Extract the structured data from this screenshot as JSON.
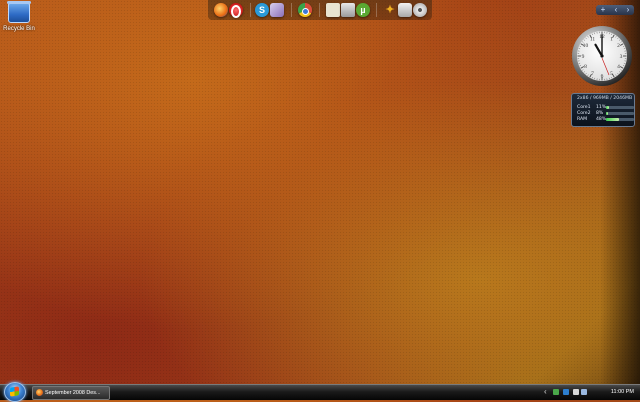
{
  "desktop": {
    "icons": [
      {
        "label": "Recycle Bin",
        "icon": "recycle-bin-icon"
      }
    ]
  },
  "dock": {
    "items": [
      {
        "name": "firefox",
        "icon": "firefox-icon",
        "color": "#e8771c"
      },
      {
        "name": "opera",
        "icon": "opera-icon",
        "color": "#d21f1f"
      },
      {
        "name": "skype",
        "icon": "skype-icon",
        "color": "#2a9ad8"
      },
      {
        "name": "messenger",
        "icon": "messenger-icon",
        "color": "#8a6fb8"
      },
      {
        "name": "chrome",
        "icon": "chrome-icon",
        "color": "#d94c3a"
      },
      {
        "name": "notepad",
        "icon": "notepad-icon",
        "color": "#e8e4d0"
      },
      {
        "name": "installer",
        "icon": "installer-icon",
        "color": "#c9c9c9"
      },
      {
        "name": "utorrent",
        "icon": "utorrent-icon",
        "color": "#5aa832"
      },
      {
        "name": "cleaner",
        "icon": "broom-icon",
        "color": "#f0b020"
      },
      {
        "name": "tools",
        "icon": "tools-icon",
        "color": "#d8d8d8"
      },
      {
        "name": "media",
        "icon": "disc-icon",
        "color": "#b8b8b8"
      }
    ]
  },
  "gadgets": {
    "controls": {
      "add": "+",
      "prev": "‹",
      "next": "›"
    },
    "clock": {
      "hour": 11,
      "minute": 0
    },
    "cpu_meter": {
      "header": "2x86 / 969MB / 2046MB",
      "rows": [
        {
          "label": "Core1",
          "value": "11%",
          "fill": 0.11
        },
        {
          "label": "Core2",
          "value": "8%",
          "fill": 0.08
        },
        {
          "label": "RAM",
          "value": "48%",
          "fill": 0.48
        }
      ]
    }
  },
  "taskbar": {
    "start_button": "Start",
    "tasks": [
      {
        "label": "September 2008 Des...",
        "icon": "firefox-icon"
      }
    ],
    "tray": {
      "expand": "‹",
      "icons": [
        "shield-icon",
        "network-icon",
        "volume-icon",
        "speaker-icon"
      ],
      "time": "11:00 PM"
    }
  }
}
